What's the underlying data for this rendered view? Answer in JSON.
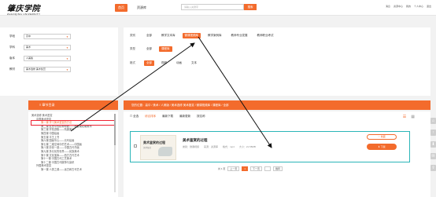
{
  "header": {
    "logo_cn": "肇庆学院",
    "logo_en": "ZHAOQING UNIVERSITY",
    "nav": [
      "首页",
      "资源库"
    ],
    "search_placeholder": "请输入关键字",
    "search_button": "搜索",
    "user_menu": [
      "消息",
      "资源中心",
      "我的",
      "个人中心",
      "退出"
    ]
  },
  "filters": {
    "rows": [
      {
        "label": "学段",
        "value": "高中"
      },
      {
        "label": "学科",
        "value": "美术"
      },
      {
        "label": "版本",
        "value": "人美版"
      },
      {
        "label": "教材",
        "value": "美术选修 美术鉴赏"
      }
    ]
  },
  "options": {
    "type": {
      "label": "类别",
      "items": [
        "全部",
        "教学文本库",
        "微课视频库",
        "教学案例库",
        "教师专业发展",
        "教师职业考试"
      ],
      "active": 2
    },
    "subtype": {
      "label": "类型",
      "items": [
        "全部",
        "课程库"
      ],
      "active": 1
    },
    "format": {
      "label": "格式",
      "items": [
        "全部",
        "视频",
        "动画",
        "文本"
      ],
      "active": 0
    }
  },
  "catalog": {
    "title": "章节目录",
    "breadcrumb": "您的位置：高中 / 美术 / 人美版 / 美术选修 美术鉴赏 / 微课视频库 / 课程库 / 全部"
  },
  "tree": [
    {
      "level": 0,
      "text": "美术选修 美术鉴赏"
    },
    {
      "level": 1,
      "text": "中国美术鉴赏"
    },
    {
      "level": 2,
      "text": "第一课 学习美术鉴赏的方法",
      "highlight": true
    },
    {
      "level": 2,
      "text": "第二课 乱世中的精神奇葩——魏晋南北朝美术"
    },
    {
      "level": 2,
      "text": "第三课 开拓进取——隋唐美术"
    },
    {
      "level": 2,
      "text": "第四课 中国绘画"
    },
    {
      "level": 2,
      "text": "第五课 平王上书"
    },
    {
      "level": 2,
      "text": "第六课 国画写心——元代绘画"
    },
    {
      "level": 2,
      "text": "第七课 二维空间中的艺术——中国画"
    },
    {
      "level": 2,
      "text": "第八课 妙景一道——中国古代书画"
    },
    {
      "level": 2,
      "text": "第九课 多元化的世界——民族美术"
    },
    {
      "level": 2,
      "text": "第十课 文化宝库——西方古代艺术"
    },
    {
      "level": 2,
      "text": "第十一课 中国古代工艺美术"
    },
    {
      "level": 2,
      "text": "第十二课 中国古代服饰与染织"
    },
    {
      "level": 1,
      "text": "外国美术鉴赏"
    },
    {
      "level": 2,
      "text": "第一课 人类之源——远古和古代艺术"
    }
  ],
  "toolbar": {
    "select_all": "全选",
    "sorts": [
      "综合排序",
      "最新下载",
      "最新更新",
      "按名称"
    ],
    "active_sort": 0
  },
  "item": {
    "thumb_title": "美术鉴赏的过程",
    "thumb_sub": "美术鉴赏",
    "title": "美术鉴赏的过程",
    "meta": [
      "类别：微课视频",
      "来源：资源库",
      "格式：mp4",
      "大小：21.58MB"
    ],
    "fav": "收藏",
    "download": "下载"
  },
  "pager": {
    "prev": "上一页",
    "pages": [
      "1"
    ],
    "current": 0,
    "next": "下一页",
    "goto": "跳转"
  }
}
